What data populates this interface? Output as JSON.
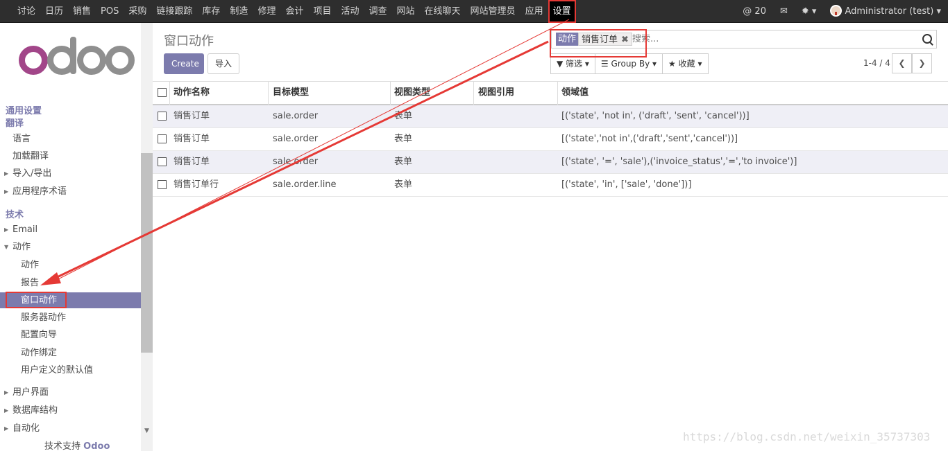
{
  "topbar": {
    "apps": [
      "讨论",
      "日历",
      "销售",
      "POS",
      "采购",
      "链接跟踪",
      "库存",
      "制造",
      "修理",
      "会计",
      "项目",
      "活动",
      "调查",
      "网站",
      "在线聊天",
      "网站管理员",
      "应用",
      "设置"
    ],
    "active_app": "设置",
    "mentions": "@ 20",
    "user": "Administrator (test)"
  },
  "sidebar": {
    "logo_alt": "odoo",
    "section_general": "通用设置",
    "section_translate": "翻译",
    "translate_items": [
      "语言",
      "加载翻译"
    ],
    "collapsed_items_1": [
      "导入/导出",
      "应用程序术语"
    ],
    "section_tech": "技术",
    "email": "Email",
    "actions_group": "动作",
    "actions_items": [
      "动作",
      "报告",
      "窗口动作",
      "服务器动作",
      "配置向导",
      "动作绑定",
      "用户定义的默认值"
    ],
    "active_item": "窗口动作",
    "collapsed_items_2": [
      "用户界面",
      "数据库结构",
      "自动化"
    ],
    "support_prefix": "技术支持",
    "support_brand": "Odoo"
  },
  "control_panel": {
    "title": "窗口动作",
    "create_label": "Create",
    "import_label": "导入",
    "facet_key": "动作",
    "facet_value": "销售订单",
    "search_placeholder": "搜索...",
    "filter_label": "筛选",
    "groupby_label": "Group By",
    "favorites_label": "收藏",
    "pager": "1-4 / 4"
  },
  "list": {
    "columns": [
      "动作名称",
      "目标模型",
      "视图类型",
      "视图引用",
      "领域值"
    ],
    "rows": [
      {
        "name": "销售订单",
        "model": "sale.order",
        "view_type": "表单",
        "view_ref": "",
        "domain": "[('state', 'not in', ('draft', 'sent', 'cancel'))]"
      },
      {
        "name": "销售订单",
        "model": "sale.order",
        "view_type": "表单",
        "view_ref": "",
        "domain": "[('state','not in',('draft','sent','cancel'))]"
      },
      {
        "name": "销售订单",
        "model": "sale.order",
        "view_type": "表单",
        "view_ref": "",
        "domain": "[('state', '=', 'sale'),('invoice_status','=','to invoice')]"
      },
      {
        "name": "销售订单行",
        "model": "sale.order.line",
        "view_type": "表单",
        "view_ref": "",
        "domain": "[('state', 'in', ['sale', 'done'])]"
      }
    ]
  },
  "watermark": "https://blog.csdn.net/weixin_35737303",
  "colors": {
    "accent": "#7c7bad",
    "annotation": "#e53935",
    "topbar": "#2e2e2e"
  }
}
